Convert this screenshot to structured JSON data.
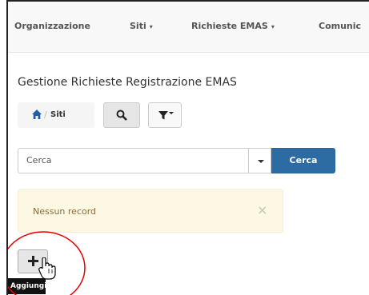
{
  "navbar": {
    "items": [
      {
        "label": "Organizzazione",
        "dropdown": false
      },
      {
        "label": "Siti",
        "dropdown": true
      },
      {
        "label": "Richieste EMAS",
        "dropdown": true
      },
      {
        "label": "Comunic",
        "dropdown": false
      }
    ]
  },
  "page": {
    "title": "Gestione Richieste Registrazione EMAS"
  },
  "breadcrumb": {
    "separator": "/",
    "item": "Siti"
  },
  "toolbar": {
    "search_icon": "search-icon",
    "filter_icon": "filter-icon"
  },
  "search": {
    "value": "Cerca",
    "button_label": "Cerca"
  },
  "alert": {
    "message": "Nessun record",
    "close_glyph": "×"
  },
  "add": {
    "icon": "plus-icon",
    "tooltip": "Aggiungi"
  },
  "colors": {
    "primary": "#2d6ca2",
    "warning_bg": "#fcf8e3",
    "warning_text": "#8a6d3b",
    "highlight": "#e60000"
  }
}
